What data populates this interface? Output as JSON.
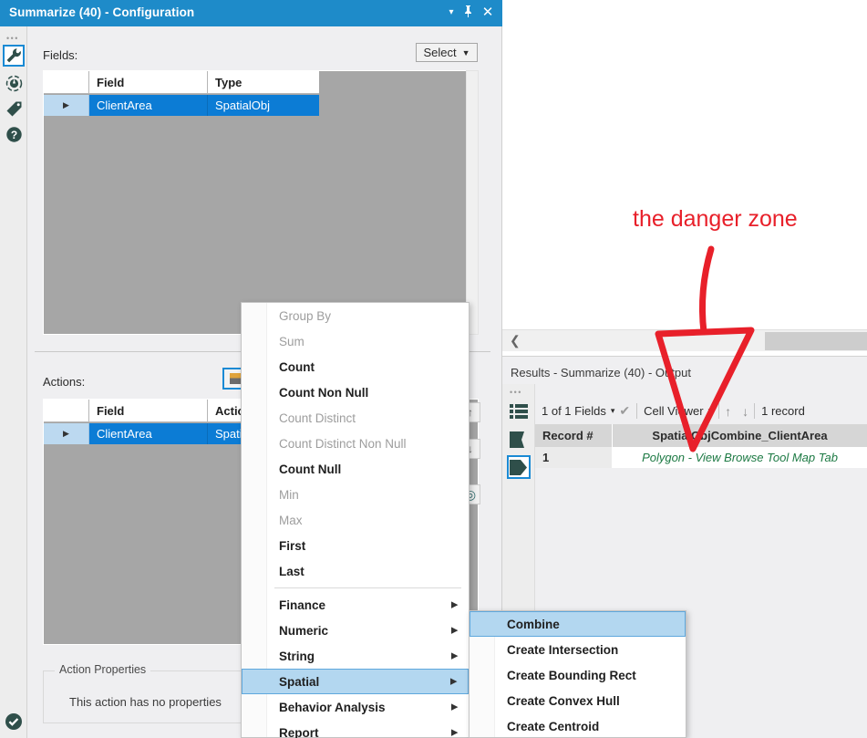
{
  "config_panel": {
    "title": "Summarize (40) - Configuration",
    "titlebar_buttons": {
      "caret": "▾",
      "pin": "📌",
      "close": "✕"
    },
    "rail_dots": "•••",
    "icons": [
      {
        "name": "wrench-icon",
        "selected": true
      },
      {
        "name": "target-icon",
        "selected": false
      },
      {
        "name": "tag-icon",
        "selected": false
      },
      {
        "name": "help-icon",
        "selected": false
      }
    ],
    "status_icon": "check-circle-icon",
    "fields": {
      "label": "Fields:",
      "select_button": "Select",
      "select_caret": "▼",
      "columns": [
        "",
        "Field",
        "Type"
      ],
      "rows": [
        {
          "handle": "▶",
          "field": "ClientArea",
          "type": "SpatialObj"
        }
      ]
    },
    "actions": {
      "label": "Actions:",
      "columns": [
        "",
        "Field",
        "Action"
      ],
      "rows": [
        {
          "handle": "▶",
          "field": "ClientArea",
          "action": "Spatial"
        }
      ]
    },
    "side_buttons": [
      "up-arrow",
      "down-arrow",
      "refresh-circle"
    ],
    "action_properties": {
      "legend": "Action Properties",
      "text": "This action has no properties"
    }
  },
  "context_menu": {
    "items": [
      {
        "label": "Group By",
        "state": "disabled",
        "submenu": false
      },
      {
        "label": "Sum",
        "state": "disabled",
        "submenu": false
      },
      {
        "label": "Count",
        "state": "enabled",
        "submenu": false
      },
      {
        "label": "Count Non Null",
        "state": "enabled",
        "submenu": false
      },
      {
        "label": "Count Distinct",
        "state": "disabled",
        "submenu": false
      },
      {
        "label": "Count Distinct Non Null",
        "state": "disabled",
        "submenu": false
      },
      {
        "label": "Count Null",
        "state": "enabled",
        "submenu": false
      },
      {
        "label": "Min",
        "state": "disabled",
        "submenu": false
      },
      {
        "label": "Max",
        "state": "disabled",
        "submenu": false
      },
      {
        "label": "First",
        "state": "enabled",
        "submenu": false
      },
      {
        "label": "Last",
        "state": "enabled",
        "submenu": false
      },
      {
        "separator": true
      },
      {
        "label": "Finance",
        "state": "enabled",
        "submenu": true
      },
      {
        "label": "Numeric",
        "state": "enabled",
        "submenu": true
      },
      {
        "label": "String",
        "state": "enabled",
        "submenu": true
      },
      {
        "label": "Spatial",
        "state": "selected",
        "submenu": true
      },
      {
        "label": "Behavior Analysis",
        "state": "enabled",
        "submenu": true
      },
      {
        "label": "Report",
        "state": "enabled",
        "submenu": true
      }
    ],
    "submenu_arrow": "▶"
  },
  "sub_menu": {
    "items": [
      {
        "label": "Combine",
        "state": "selected"
      },
      {
        "label": "Create Intersection",
        "state": "enabled"
      },
      {
        "label": "Create Bounding Rect",
        "state": "enabled"
      },
      {
        "label": "Create Convex Hull",
        "state": "enabled"
      },
      {
        "label": "Create Centroid",
        "state": "enabled"
      }
    ]
  },
  "canvas": {
    "hscroll_left_chevron": "❮"
  },
  "results": {
    "title": "Results - Summarize (40) - Output",
    "rail_dots": "•••",
    "rail_icons": [
      {
        "name": "records-list-icon",
        "selected": false
      },
      {
        "name": "data-table-icon",
        "selected": false
      },
      {
        "name": "map-polygon-icon",
        "selected": true
      }
    ],
    "toolbar": {
      "fields_selector": "1 of 1 Fields",
      "fields_caret": "▾",
      "check": "✔",
      "cell_viewer": "Cell Viewer",
      "cell_viewer_caret": "▾",
      "up_arrow": "↑",
      "down_arrow": "↓",
      "record_count": "1 record"
    },
    "table": {
      "columns": [
        "Record #",
        "SpatialObjCombine_ClientArea"
      ],
      "rows": [
        {
          "record": "1",
          "value": "Polygon - View Browse Tool Map Tab"
        }
      ]
    }
  },
  "annotation": {
    "text": "the danger zone",
    "color": "#e8202a"
  },
  "colors": {
    "titlebar": "#1e8bc9",
    "selection_blue": "#0c7cd5",
    "menu_highlight": "#b3d7f0",
    "annotation_red": "#e8202a",
    "spatial_green": "#1d7a44"
  }
}
